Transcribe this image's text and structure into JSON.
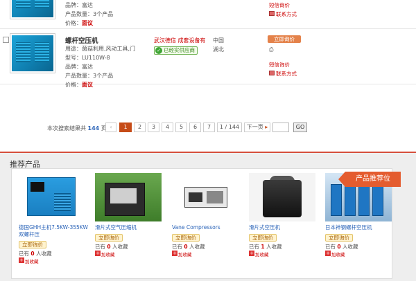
{
  "row1": {
    "brand": "品牌：富达",
    "qty": "产品数量：3个产品",
    "price_label": "价格：",
    "price_value": "面议",
    "sms": "短信询价",
    "contact": "联系方式"
  },
  "row2": {
    "title": "螺杆空压机",
    "usage": "用途：菌菇利用,风动工具,门",
    "model": "型号：LU110W-8",
    "brand": "品牌：富达",
    "qty": "产品数量：3个产品",
    "price_label": "价格：",
    "price_value": "面议",
    "company": "武汉德信 成套设备有",
    "cert": "已经实供应商",
    "loc_country": "中国",
    "loc_province": "湖北",
    "ask_button": "立即询价",
    "sms": "短信询价",
    "contact": "联系方式"
  },
  "pager": {
    "total_prefix": "本次搜索结果共",
    "total": "144",
    "total_suffix": "页",
    "prev": "‹",
    "pages": [
      "1",
      "2",
      "3",
      "4",
      "5",
      "6",
      "7"
    ],
    "current_page": "1",
    "page_status": "1 / 144",
    "next": "下一页",
    "go": "GO"
  },
  "recommend": {
    "title": "推荐产品",
    "badge": "产品推荐位",
    "ask_button": "立即询价",
    "add_fav": "加收藏",
    "items": [
      {
        "name": "德国GHH主机7.5KW-355KW双螺杆压",
        "fav_prefix": "已有",
        "fav_count": "0",
        "fav_suffix": "人收藏"
      },
      {
        "name": "滑片式空气压缩机",
        "fav_prefix": "已有",
        "fav_count": "0",
        "fav_suffix": "人收藏"
      },
      {
        "name": "Vane Compressors",
        "fav_prefix": "已有",
        "fav_count": "0",
        "fav_suffix": "人收藏"
      },
      {
        "name": "滑片式空压机",
        "fav_prefix": "已有",
        "fav_count": "1",
        "fav_suffix": "人收藏"
      },
      {
        "name": "日本神钢螺杆空压机",
        "fav_prefix": "已有",
        "fav_count": "0",
        "fav_suffix": "人收藏"
      }
    ]
  },
  "colors": {
    "accent_orange": "#e45c2f",
    "page_current": "#c64b17",
    "link_blue": "#2a63b8",
    "price_red": "#cc0000"
  }
}
